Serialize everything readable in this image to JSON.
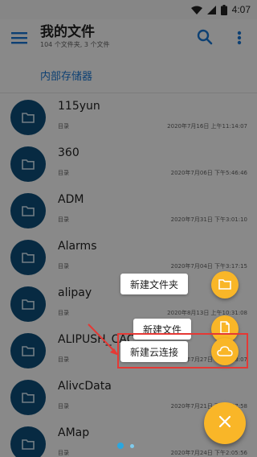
{
  "status_bar": {
    "time": "4:07"
  },
  "header": {
    "title": "我的文件",
    "subtitle": "104 个文件夹, 3 个文件"
  },
  "breadcrumb": {
    "label": "内部存储器"
  },
  "files": [
    {
      "name": "115yun",
      "type": "目录",
      "date": "2020年7月16日 上午11:14:07"
    },
    {
      "name": "360",
      "type": "目录",
      "date": "2020年7月06日 下午5:46:46"
    },
    {
      "name": "ADM",
      "type": "目录",
      "date": "2020年7月31日 下午3:01:10"
    },
    {
      "name": "Alarms",
      "type": "目录",
      "date": "2020年7月04日 下午3:17:15"
    },
    {
      "name": "alipay",
      "type": "目录",
      "date": "2020年8月13日 上午10:31:08"
    },
    {
      "name": "ALIPUSH_CAC",
      "type": "目录",
      "date": "2020年7月27日 下午3:33:07"
    },
    {
      "name": "AlivcData",
      "type": "目录",
      "date": "2020年7月21日 下午2:37:58"
    },
    {
      "name": "AMap",
      "type": "目录",
      "date": "2020年7月24日 下午2:05:56"
    }
  ],
  "fab_menu": {
    "new_folder": "新建文件夹",
    "new_file": "新建文件",
    "new_cloud": "新建云连接"
  },
  "colors": {
    "accent": "#f9b628",
    "folder_avatar": "#0d4d78",
    "link": "#1976d2",
    "highlight": "#e53935"
  }
}
